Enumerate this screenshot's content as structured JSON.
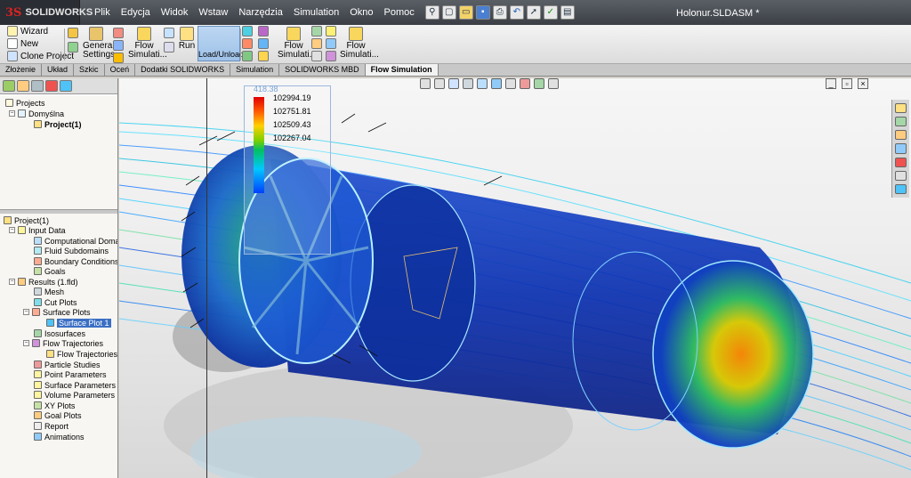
{
  "app": {
    "brand": "SOLIDWORKS",
    "brand_mark": "3S",
    "document_title": "Holonur.SLDASM *"
  },
  "menu": [
    "Plik",
    "Edycja",
    "Widok",
    "Wstaw",
    "Narzędzia",
    "Simulation",
    "Okno",
    "Pomoc"
  ],
  "command_manager": {
    "wizard": "Wizard",
    "new": "New",
    "clone_project": "Clone Project",
    "general_settings_1": "General",
    "general_settings_2": "Settings",
    "flow_simulation_1": "Flow",
    "flow_simulation_2": "Simulati...",
    "run": "Run",
    "load_unload": "Load/Unload",
    "flow_simulation_b1": "Flow",
    "flow_simulation_b2": "Simulati...",
    "flow_simulation_c1": "Flow",
    "flow_simulation_c2": "Simulati..."
  },
  "tabs": [
    "Złożenie",
    "Układ",
    "Szkic",
    "Oceń",
    "Dodatki SOLIDWORKS",
    "Simulation",
    "SOLIDWORKS MBD",
    "Flow Simulation"
  ],
  "active_tab": "Flow Simulation",
  "projects_tree": {
    "root": "Projects",
    "config": "Domyślna",
    "project": "Project(1)"
  },
  "analysis_tree": {
    "root": "Project(1)",
    "input_data": "Input Data",
    "computational_domain": "Computational Domain",
    "fluid_subdomains": "Fluid Subdomains",
    "boundary_conditions": "Boundary Conditions",
    "goals": "Goals",
    "results": "Results (1.fld)",
    "mesh": "Mesh",
    "cut_plots": "Cut Plots",
    "surface_plots": "Surface Plots",
    "surface_plot_1": "Surface Plot 1",
    "isosurfaces": "Isosurfaces",
    "flow_trajectories": "Flow Trajectories",
    "flow_trajectories_1": "Flow Trajectories 1",
    "particle_studies": "Particle Studies",
    "point_parameters": "Point Parameters",
    "surface_parameters": "Surface Parameters",
    "volume_parameters": "Volume Parameters",
    "xy_plots": "XY Plots",
    "goal_plots": "Goal Plots",
    "report": "Report",
    "animations": "Animations"
  },
  "legend": {
    "top_label": "418.38",
    "values": [
      "102994.19",
      "102751.81",
      "102509.43",
      "102267.04"
    ]
  },
  "colors": {
    "legend_max": "#e00000",
    "legend_min": "#0040ff",
    "selection": "#3a6fc4",
    "active_load_button": "#9fc2e8"
  }
}
